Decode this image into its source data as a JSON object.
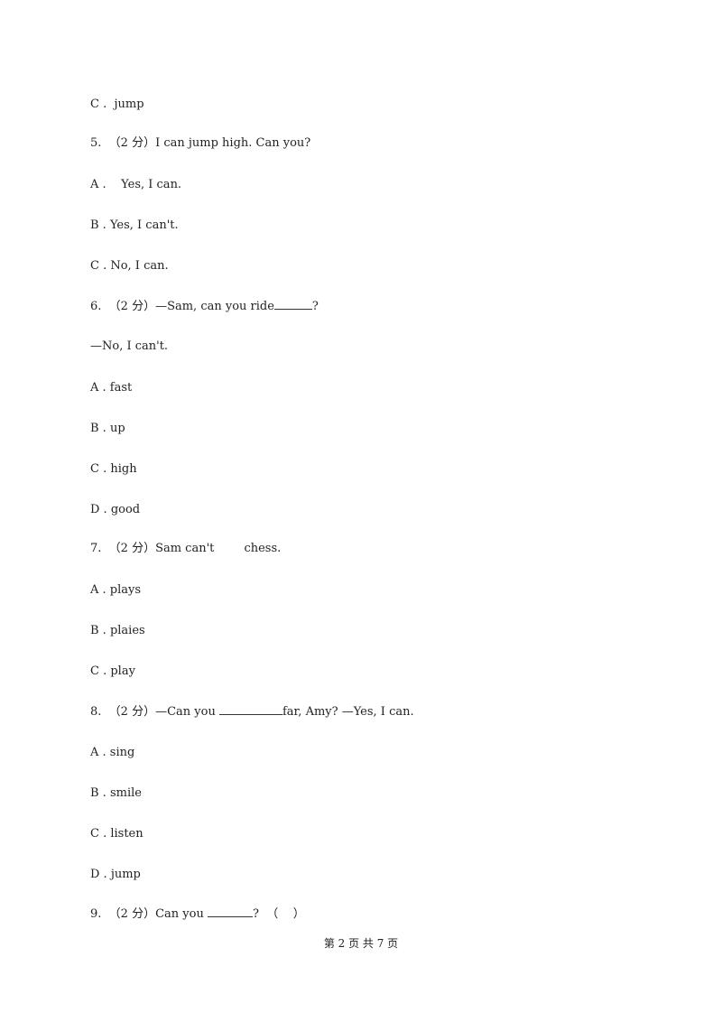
{
  "lines": [
    {
      "text": "C .  jump"
    },
    {
      "text": "5.  （2 分）I can jump high. Can you?"
    },
    {
      "text": "A .    Yes, I can."
    },
    {
      "text": "B . Yes, I can't."
    },
    {
      "text": "C . No, I can."
    },
    {
      "q6_pre": "6.  （2 分）—Sam, can you ride",
      "q6_post": "?"
    },
    {
      "text": "—No, I can't."
    },
    {
      "text": "A . fast"
    },
    {
      "text": "B . up"
    },
    {
      "text": "C . high"
    },
    {
      "text": "D . good"
    },
    {
      "text": "7.  （2 分）Sam can't        chess."
    },
    {
      "text": "A . plays"
    },
    {
      "text": "B . plaies"
    },
    {
      "text": "C . play"
    },
    {
      "q8_pre": "8.  （2 分）—Can you ",
      "q8_post": "far, Amy? —Yes, I can."
    },
    {
      "text": "A . sing"
    },
    {
      "text": "B . smile"
    },
    {
      "text": "C . listen"
    },
    {
      "text": "D . jump"
    },
    {
      "q9_pre": "9.  （2 分）Can you ",
      "q9_post": "?  （    ）"
    }
  ],
  "footer": "第 2 页 共 7 页"
}
